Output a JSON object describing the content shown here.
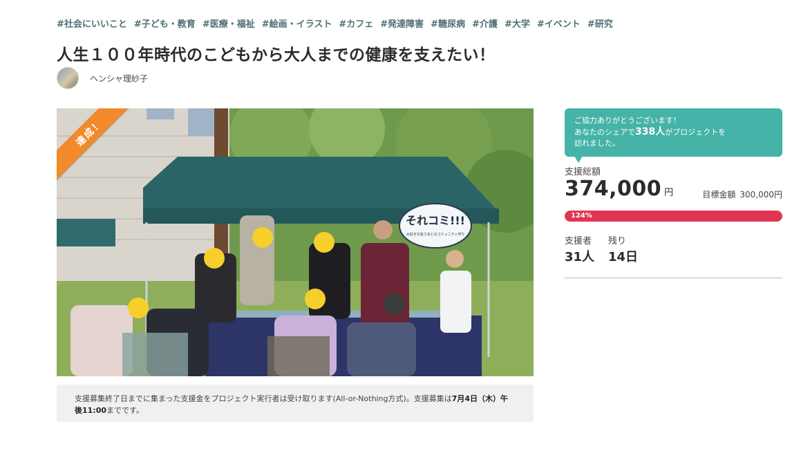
{
  "tags": [
    "#社会にいいこと",
    "#子ども・教育",
    "#医療・福祉",
    "#絵画・イラスト",
    "#カフェ",
    "#発達障害",
    "#糖尿病",
    "#介護",
    "#大学",
    "#イベント",
    "#研究"
  ],
  "title": "人生１００年時代のこどもから大人までの健康を支えたい！",
  "owner": {
    "name": "ヘンシャ理紗子"
  },
  "photo": {
    "ribbon": "達成！",
    "sign": "それコミ!!!",
    "sign_sub": "大好きな皆さまとのコミュニティ作り"
  },
  "notice": {
    "text": "支援募集終了日までに集まった支援金をプロジェクト実行者は受け取ります(All-or-Nothing方式)。支援募集は",
    "deadline": "7月4日（木）午後11:00",
    "suffix": "までです。"
  },
  "share": {
    "line1": "ご協力ありがとうございます！",
    "line2_prefix": "あなたのシェアで",
    "count": "338人",
    "line2_suffix": "がプロジェクトを",
    "line3": "訪れました。"
  },
  "funding": {
    "total_label": "支援総額",
    "total": "374,000",
    "unit": "円",
    "goal_label": "目標金額",
    "goal": "300,000円",
    "percent_label": "124%",
    "progress": 1.0,
    "supporters_label": "支援者",
    "supporters": "31人",
    "remaining_label": "残り",
    "remaining": "14日"
  },
  "colors": {
    "accent": "#45b3a7",
    "progress": "#e03552",
    "ribbon": "#f08a2b",
    "tag": "#4f6f74"
  }
}
